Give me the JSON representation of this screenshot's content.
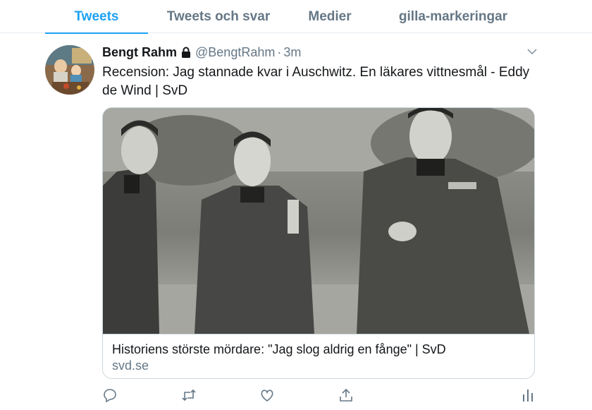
{
  "tabs": [
    {
      "label": "Tweets",
      "active": true
    },
    {
      "label": "Tweets och svar",
      "active": false
    },
    {
      "label": "Medier",
      "active": false
    },
    {
      "label": "gilla-markeringar",
      "active": false
    }
  ],
  "tweet": {
    "author_name": "Bengt Rahm",
    "author_handle": "@BengtRahm",
    "separator": "·",
    "time": "3m",
    "text": "Recension: Jag stannade kvar i Auschwitz. En läkares vittnesmål - Eddy de Wind | SvD",
    "card": {
      "title": "Historiens störste mördare: \"Jag slog aldrig en fånge\" | SvD",
      "domain": "svd.se"
    },
    "actions": [
      "reply-icon",
      "retweet-icon",
      "like-icon",
      "share-icon",
      "analytics-icon"
    ]
  },
  "colors": {
    "accent": "#1da1f2",
    "secondary_text": "#657786",
    "border": "#ccd6dd"
  }
}
